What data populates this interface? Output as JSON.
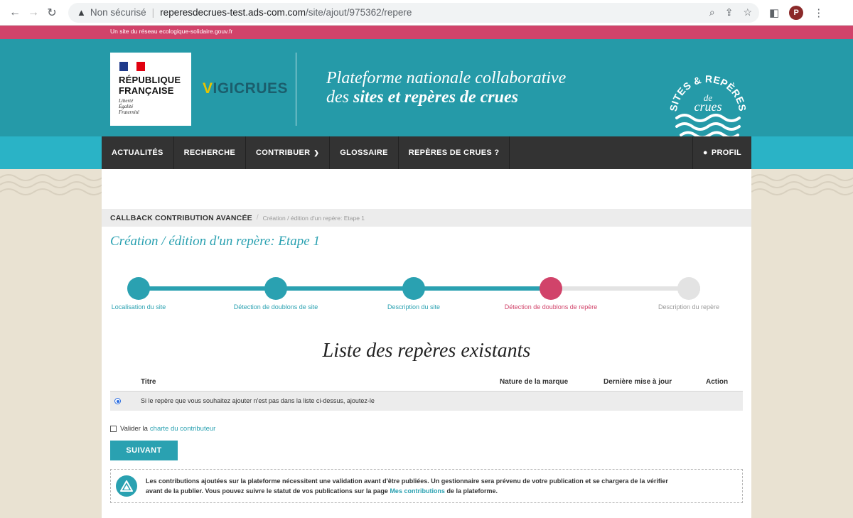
{
  "browser": {
    "security": "Non sécurisé",
    "host": "reperesdecrues-test.ads-com.com",
    "path": "/site/ajout/975362/repere",
    "avatar": "P"
  },
  "network_bar": "Un site du réseau ecologique-solidaire.gouv.fr",
  "header": {
    "rf_line1": "RÉPUBLIQUE",
    "rf_line2": "FRANÇAISE",
    "motto": [
      "Liberté",
      "Égalité",
      "Fraternité"
    ],
    "vigicrues_v": "V",
    "vigicrues_rest": "IGICRUES",
    "tagline_line1": "Plateforme nationale collaborative",
    "tagline_line2_prefix": "des ",
    "tagline_line2_bold": "sites et repères de crues",
    "badge_top": "SITES & REPÈRES",
    "badge_de": "de",
    "badge_crues": "crues"
  },
  "nav": {
    "items": [
      "ACTUALITÉS",
      "RECHERCHE",
      "CONTRIBUER",
      "GLOSSAIRE",
      "REPÈRES DE CRUES ?"
    ],
    "profile": "PROFIL"
  },
  "breadcrumb": {
    "root": "CALLBACK CONTRIBUTION AVANCÉE",
    "sep": "/",
    "current": "Création / édition d'un repère: Etape 1"
  },
  "page_title": "Création / édition d'un repère: Etape 1",
  "steps": [
    {
      "label": "Localisation du site",
      "state": "done"
    },
    {
      "label": "Détection de doublons de site",
      "state": "done"
    },
    {
      "label": "Description du site",
      "state": "done"
    },
    {
      "label": "Détection de doublons de repère",
      "state": "current"
    },
    {
      "label": "Description du repère",
      "state": "todo"
    }
  ],
  "list_title": "Liste des repères existants",
  "table": {
    "columns": [
      "Titre",
      "Nature de la marque",
      "Dernière mise à jour",
      "Action"
    ],
    "rows": [
      {
        "text": "Si le repère que vous souhaitez ajouter n'est pas dans la liste ci-dessus, ajoutez-le",
        "selected": true
      }
    ]
  },
  "charter": {
    "prefix": "Valider la",
    "link": "charte du contributeur"
  },
  "next_button": "SUIVANT",
  "notice": {
    "line1": "Les contributions ajoutées sur la plateforme nécessitent une validation avant d'être publiées. Un gestionnaire sera prévenu de votre publication et se chargera de la vérifier",
    "line2_prefix": "avant de la publier. Vous pouvez suivre le statut de vos publications sur la page ",
    "line2_link": "Mes contributions",
    "line2_suffix": " de la plateforme."
  },
  "colors": {
    "teal": "#2aa1b1",
    "header_teal": "#259aa8",
    "pink": "#d1436a",
    "nav_dark": "#333333",
    "sand": "#e9e2d2"
  }
}
